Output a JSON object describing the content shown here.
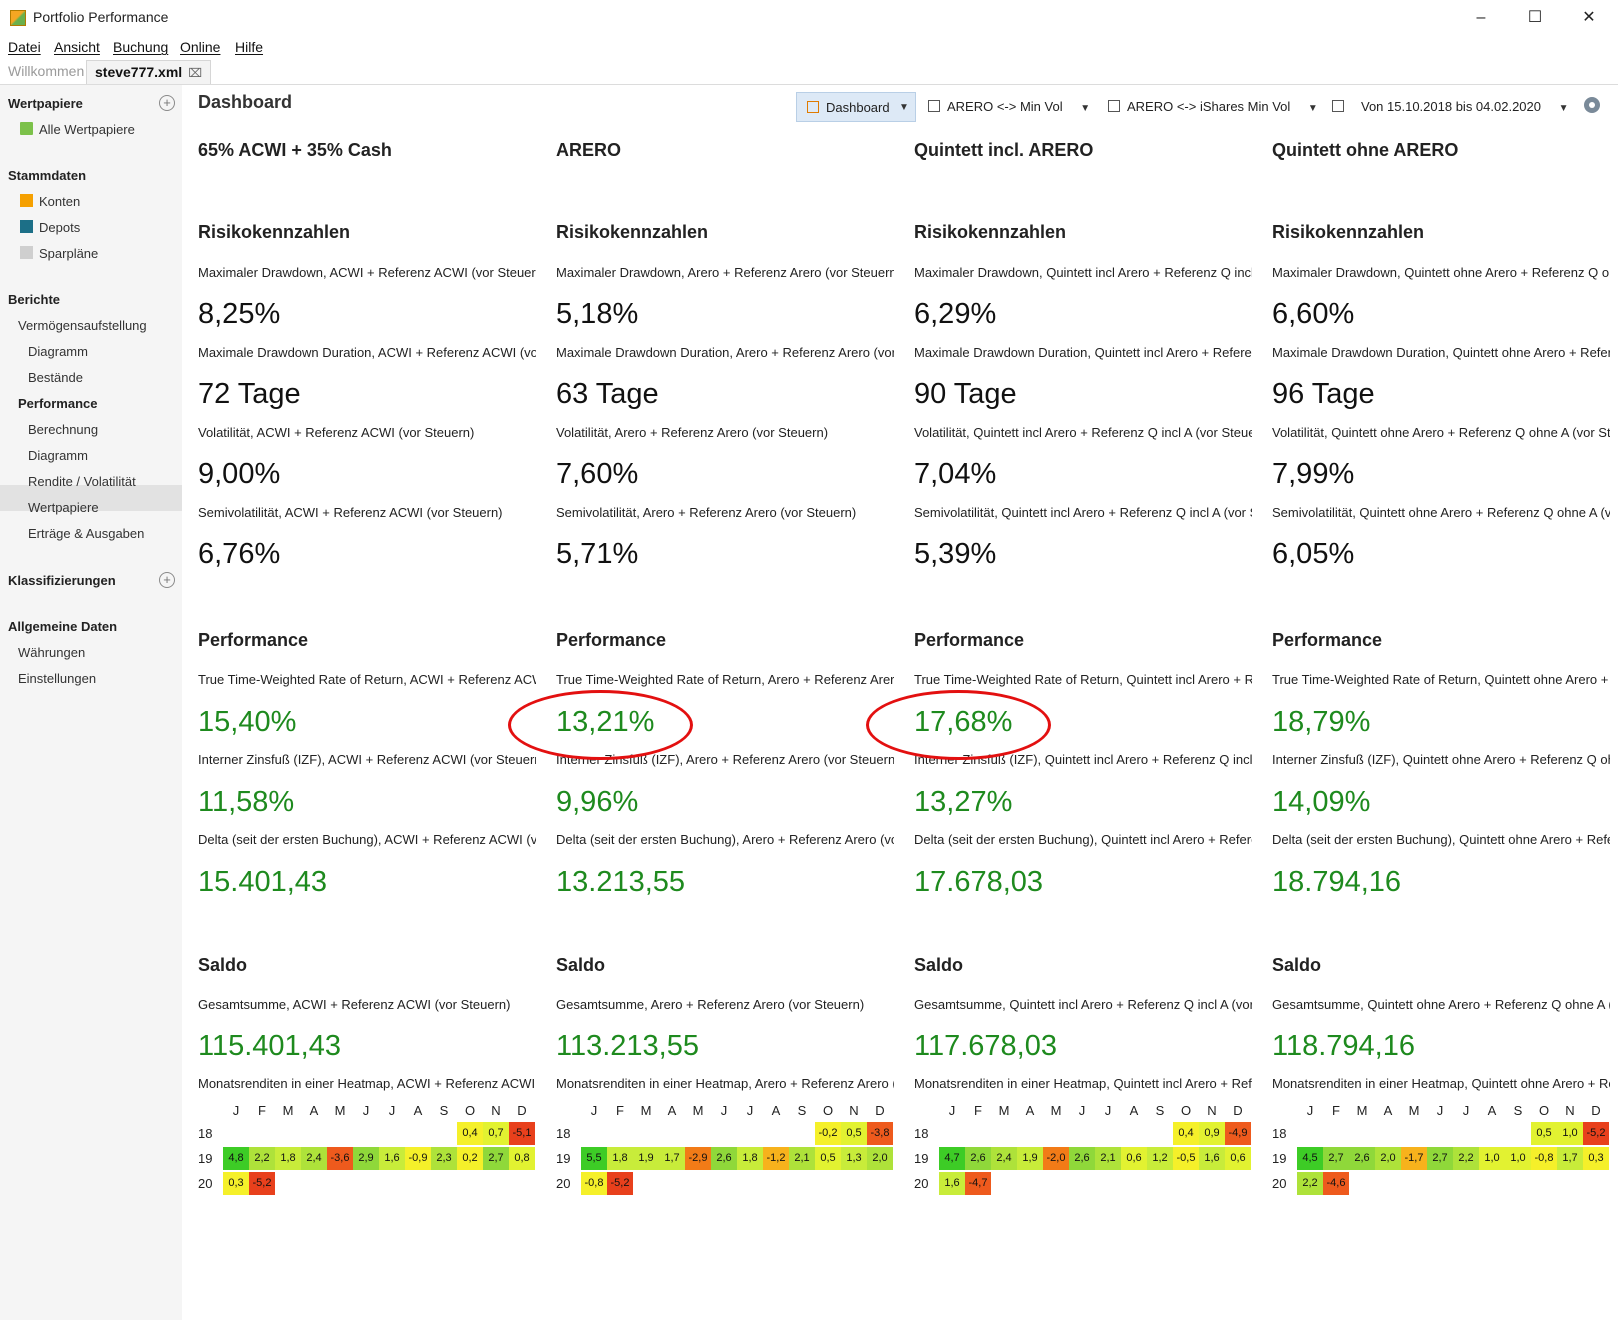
{
  "window": {
    "title": "Portfolio Performance"
  },
  "menu": [
    "Datei",
    "Ansicht",
    "Buchung",
    "Online",
    "Hilfe"
  ],
  "tabs": [
    {
      "label": "Willkommen",
      "active": false
    },
    {
      "label": "steve777.xml",
      "active": true
    }
  ],
  "sidebar": {
    "wertpapiere": "Wertpapiere",
    "alle_wertpapiere": "Alle Wertpapiere",
    "stammdaten": "Stammdaten",
    "konten": "Konten",
    "depots": "Depots",
    "sparplaene": "Sparpläne",
    "berichte": "Berichte",
    "vermoegensaufstellung": "Vermögensaufstellung",
    "diagramm1": "Diagramm",
    "bestaende": "Bestände",
    "performance": "Performance",
    "berechnung": "Berechnung",
    "diagramm2": "Diagramm",
    "rendite_volatilitaet": "Rendite / Volatilität",
    "wertpapiere2": "Wertpapiere",
    "ertraege": "Erträge & Ausgaben",
    "klassifizierungen": "Klassifizierungen",
    "allgemeine_daten": "Allgemeine Daten",
    "waehrungen": "Währungen",
    "einstellungen": "Einstellungen"
  },
  "toolbar": {
    "title": "Dashboard",
    "dashboard_btn": "Dashboard",
    "dash2": "ARERO <-> Min Vol",
    "dash3": "ARERO <-> iShares Min Vol",
    "period": "Von 15.10.2018 bis 04.02.2020"
  },
  "sections": {
    "risk": "Risikokennzahlen",
    "perf": "Performance",
    "saldo": "Saldo"
  },
  "months": [
    "J",
    "F",
    "M",
    "A",
    "M",
    "J",
    "J",
    "A",
    "S",
    "O",
    "N",
    "D"
  ],
  "columns": [
    {
      "title": "65% ACWI + 35% Cash",
      "risk": [
        {
          "label": "Maximaler Drawdown, ACWI + Referenz ACWI (vor Steuern)",
          "value": "8,25%"
        },
        {
          "label": "Maximale Drawdown Duration, ACWI + Referenz ACWI (vor Steuern)",
          "value": "72 Tage"
        },
        {
          "label": "Volatilität, ACWI + Referenz ACWI (vor Steuern)",
          "value": "9,00%"
        },
        {
          "label": "Semivolatilität, ACWI + Referenz ACWI (vor Steuern)",
          "value": "6,76%"
        }
      ],
      "perf": [
        {
          "label": "True Time-Weighted Rate of Return, ACWI + Referenz ACWI (vor Steuern)",
          "value": "15,40%"
        },
        {
          "label": "Interner Zinsfuß (IZF), ACWI + Referenz ACWI (vor Steuern)",
          "value": "11,58%"
        },
        {
          "label": "Delta (seit der ersten Buchung), ACWI + Referenz ACWI (vor Steuern)",
          "value": "15.401,43"
        }
      ],
      "saldo": {
        "label": "Gesamtsumme, ACWI + Referenz ACWI (vor Steuern)",
        "value": "115.401,43"
      },
      "heatmap": {
        "label": "Monatsrenditen in einer Heatmap, ACWI + Referenz ACWI (vor Steuern)",
        "rows": [
          {
            "year": "18",
            "values": [
              null,
              null,
              null,
              null,
              null,
              null,
              null,
              null,
              null,
              0.4,
              0.7,
              -5.1
            ],
            "labels": [
              null,
              null,
              null,
              null,
              null,
              null,
              null,
              null,
              null,
              "0,4",
              "0,7",
              "-5,1"
            ]
          },
          {
            "year": "19",
            "values": [
              4.8,
              2.2,
              1.8,
              2.4,
              -3.6,
              2.9,
              1.6,
              -0.9,
              2.3,
              0.2,
              2.7,
              0.8
            ],
            "labels": [
              "4,8",
              "2,2",
              "1,8",
              "2,4",
              "-3,6",
              "2,9",
              "1,6",
              "-0,9",
              "2,3",
              "0,2",
              "2,7",
              "0,8"
            ]
          },
          {
            "year": "20",
            "values": [
              0.3,
              -5.2,
              null,
              null,
              null,
              null,
              null,
              null,
              null,
              null,
              null,
              null
            ],
            "labels": [
              "0,3",
              "-5,2",
              null,
              null,
              null,
              null,
              null,
              null,
              null,
              null,
              null,
              null
            ]
          }
        ]
      }
    },
    {
      "title": "ARERO",
      "risk": [
        {
          "label": "Maximaler Drawdown, Arero + Referenz Arero (vor Steuern)",
          "value": "5,18%"
        },
        {
          "label": "Maximale Drawdown Duration, Arero + Referenz Arero (vor Steuern)",
          "value": "63 Tage"
        },
        {
          "label": "Volatilität, Arero + Referenz Arero (vor Steuern)",
          "value": "7,60%"
        },
        {
          "label": "Semivolatilität, Arero + Referenz Arero (vor Steuern)",
          "value": "5,71%"
        }
      ],
      "perf": [
        {
          "label": "True Time-Weighted Rate of Return, Arero + Referenz Arero (vor Steuern)",
          "value": "13,21%"
        },
        {
          "label": "Interner Zinsfuß (IZF), Arero + Referenz Arero (vor Steuern)",
          "value": "9,96%"
        },
        {
          "label": "Delta (seit der ersten Buchung), Arero + Referenz Arero (vor Steuern)",
          "value": "13.213,55"
        }
      ],
      "saldo": {
        "label": "Gesamtsumme, Arero + Referenz Arero (vor Steuern)",
        "value": "113.213,55"
      },
      "heatmap": {
        "label": "Monatsrenditen in einer Heatmap, Arero + Referenz Arero (vor Steuern)",
        "rows": [
          {
            "year": "18",
            "values": [
              null,
              null,
              null,
              null,
              null,
              null,
              null,
              null,
              null,
              -0.2,
              0.5,
              -3.8
            ],
            "labels": [
              null,
              null,
              null,
              null,
              null,
              null,
              null,
              null,
              null,
              "-0,2",
              "0,5",
              "-3,8"
            ]
          },
          {
            "year": "19",
            "values": [
              5.5,
              1.8,
              1.9,
              1.7,
              -2.9,
              2.6,
              1.8,
              -1.2,
              2.1,
              0.5,
              1.3,
              2.0
            ],
            "labels": [
              "5,5",
              "1,8",
              "1,9",
              "1,7",
              "-2,9",
              "2,6",
              "1,8",
              "-1,2",
              "2,1",
              "0,5",
              "1,3",
              "2,0"
            ]
          },
          {
            "year": "20",
            "values": [
              -0.8,
              -5.2,
              null,
              null,
              null,
              null,
              null,
              null,
              null,
              null,
              null,
              null
            ],
            "labels": [
              "-0,8",
              "-5,2",
              null,
              null,
              null,
              null,
              null,
              null,
              null,
              null,
              null,
              null
            ]
          }
        ]
      }
    },
    {
      "title": "Quintett incl. ARERO",
      "risk": [
        {
          "label": "Maximaler Drawdown, Quintett incl Arero + Referenz Q incl A (vor Steuern)",
          "value": "6,29%"
        },
        {
          "label": "Maximale Drawdown Duration, Quintett incl Arero + Referenz Q incl A (vor Steuern)",
          "value": "90 Tage"
        },
        {
          "label": "Volatilität, Quintett incl Arero + Referenz Q incl A (vor Steuern)",
          "value": "7,04%"
        },
        {
          "label": "Semivolatilität, Quintett incl Arero + Referenz Q incl A (vor Steuern)",
          "value": "5,39%"
        }
      ],
      "perf": [
        {
          "label": "True Time-Weighted Rate of Return, Quintett incl Arero + Referenz Q incl A (vor Steuern)",
          "value": "17,68%"
        },
        {
          "label": "Interner Zinsfuß (IZF), Quintett incl Arero + Referenz Q incl A (vor Steuern)",
          "value": "13,27%"
        },
        {
          "label": "Delta (seit der ersten Buchung), Quintett incl Arero + Referenz Q incl A (vor Steuern)",
          "value": "17.678,03"
        }
      ],
      "saldo": {
        "label": "Gesamtsumme, Quintett incl Arero + Referenz Q incl A (vor Steuern)",
        "value": "117.678,03"
      },
      "heatmap": {
        "label": "Monatsrenditen in einer Heatmap, Quintett incl Arero + Referenz Q incl A (vor Steuern)",
        "rows": [
          {
            "year": "18",
            "values": [
              null,
              null,
              null,
              null,
              null,
              null,
              null,
              null,
              null,
              0.4,
              0.9,
              -4.9
            ],
            "labels": [
              null,
              null,
              null,
              null,
              null,
              null,
              null,
              null,
              null,
              "0,4",
              "0,9",
              "-4,9"
            ]
          },
          {
            "year": "19",
            "values": [
              4.7,
              2.6,
              2.4,
              1.9,
              -2.0,
              2.6,
              2.1,
              0.6,
              1.2,
              -0.5,
              1.6,
              0.6
            ],
            "labels": [
              "4,7",
              "2,6",
              "2,4",
              "1,9",
              "-2,0",
              "2,6",
              "2,1",
              "0,6",
              "1,2",
              "-0,5",
              "1,6",
              "0,6"
            ]
          },
          {
            "year": "20",
            "values": [
              1.6,
              -4.7,
              null,
              null,
              null,
              null,
              null,
              null,
              null,
              null,
              null,
              null
            ],
            "labels": [
              "1,6",
              "-4,7",
              null,
              null,
              null,
              null,
              null,
              null,
              null,
              null,
              null,
              null
            ]
          }
        ]
      }
    },
    {
      "title": "Quintett ohne ARERO",
      "risk": [
        {
          "label": "Maximaler Drawdown, Quintett ohne Arero + Referenz Q ohne A (vor Steuern)",
          "value": "6,60%"
        },
        {
          "label": "Maximale Drawdown Duration, Quintett ohne Arero + Referenz Q ohne A (vor Steuern)",
          "value": "96 Tage"
        },
        {
          "label": "Volatilität, Quintett ohne Arero + Referenz Q ohne A (vor Steuern)",
          "value": "7,99%"
        },
        {
          "label": "Semivolatilität, Quintett ohne Arero + Referenz Q ohne A (vor Steuern)",
          "value": "6,05%"
        }
      ],
      "perf": [
        {
          "label": "True Time-Weighted Rate of Return, Quintett ohne Arero + Referenz Q ohne A (vor Steuern)",
          "value": "18,79%"
        },
        {
          "label": "Interner Zinsfuß (IZF), Quintett ohne Arero + Referenz Q ohne A (vor Steuern)",
          "value": "14,09%"
        },
        {
          "label": "Delta (seit der ersten Buchung), Quintett ohne Arero + Referenz Q ohne A (vor Steuern)",
          "value": "18.794,16"
        }
      ],
      "saldo": {
        "label": "Gesamtsumme, Quintett ohne Arero + Referenz Q ohne A (vor Steuern)",
        "value": "118.794,16"
      },
      "heatmap": {
        "label": "Monatsrenditen in einer Heatmap, Quintett ohne Arero + Referenz Q ohne A (vor Steuern)",
        "rows": [
          {
            "year": "18",
            "values": [
              null,
              null,
              null,
              null,
              null,
              null,
              null,
              null,
              null,
              0.5,
              1.0,
              -5.2
            ],
            "labels": [
              null,
              null,
              null,
              null,
              null,
              null,
              null,
              null,
              null,
              "0,5",
              "1,0",
              "-5,2"
            ]
          },
          {
            "year": "19",
            "values": [
              4.5,
              2.7,
              2.6,
              2.0,
              -1.7,
              2.7,
              2.2,
              1.0,
              1.0,
              -0.8,
              1.7,
              0.3
            ],
            "labels": [
              "4,5",
              "2,7",
              "2,6",
              "2,0",
              "-1,7",
              "2,7",
              "2,2",
              "1,0",
              "1,0",
              "-0,8",
              "1,7",
              "0,3"
            ]
          },
          {
            "year": "20",
            "values": [
              2.2,
              -4.6,
              null,
              null,
              null,
              null,
              null,
              null,
              null,
              null,
              null,
              null
            ],
            "labels": [
              "2,2",
              "-4,6",
              null,
              null,
              null,
              null,
              null,
              null,
              null,
              null,
              null,
              null
            ]
          }
        ]
      }
    }
  ],
  "annotations": [
    {
      "target": "columns.1.perf.0",
      "shape": "ellipse",
      "color": "#e31010"
    },
    {
      "target": "columns.2.perf.0",
      "shape": "ellipse",
      "color": "#e31010"
    }
  ]
}
